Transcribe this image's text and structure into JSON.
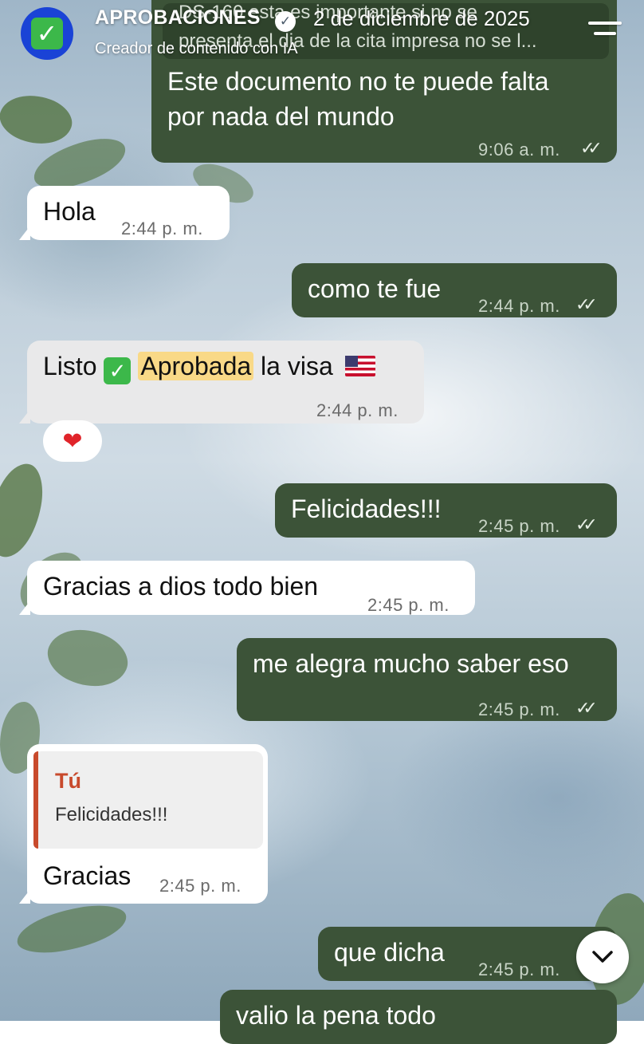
{
  "header": {
    "name": "APROBACIONES",
    "date": "2 de diciembre de 2025",
    "subtitle": "Creador de contenido con IA",
    "avatar_icon": "check-icon",
    "verified_icon": "verified-badge-icon",
    "menu_icon": "menu-icon"
  },
  "messages": [
    {
      "id": "m0",
      "direction": "out",
      "line1": "DS-160 esta es importante si no se",
      "line2": "presenta el dia de la cita impresa no se l...",
      "partial": true
    },
    {
      "id": "m1",
      "direction": "out",
      "line1": "Este documento no te puede falta",
      "line2": "por nada del mundo",
      "time": "9:06 a. m.",
      "status": "read"
    },
    {
      "id": "m2",
      "direction": "in",
      "text": "Hola",
      "time": "2:44 p. m."
    },
    {
      "id": "m3",
      "direction": "out",
      "text": "como te fue",
      "time": "2:44 p. m.",
      "status": "read"
    },
    {
      "id": "m4",
      "direction": "in",
      "pre": "Listo",
      "highlight": "Aprobada",
      "post": "la visa",
      "time": "2:44 p. m.",
      "reaction": "❤"
    },
    {
      "id": "m5",
      "direction": "out",
      "text": "Felicidades!!!",
      "time": "2:45 p. m.",
      "status": "read"
    },
    {
      "id": "m6",
      "direction": "in",
      "text": "Gracias a dios todo bien",
      "time": "2:45 p. m."
    },
    {
      "id": "m7",
      "direction": "out",
      "text": "me alegra mucho saber eso",
      "time": "2:45 p. m.",
      "status": "read"
    },
    {
      "id": "m8",
      "direction": "in",
      "reply_author": "Tú",
      "reply_text": "Felicidades!!!",
      "text": "Gracias",
      "time": "2:45 p. m."
    },
    {
      "id": "m9",
      "direction": "out",
      "text": "que dicha",
      "time": "2:45 p. m.",
      "status": "read"
    },
    {
      "id": "m10",
      "direction": "out",
      "text": "valio la pena todo",
      "partial": true
    }
  ],
  "ui": {
    "read_ticks": "✓✓",
    "scroll_down_icon": "chevron-down-icon"
  },
  "colors": {
    "outgoing_bubble": "#3c5338",
    "incoming_bubble": "#ffffff",
    "highlight": "#f9d987",
    "reply_accent": "#c84a2c",
    "avatar_bg": "#1a43d6"
  }
}
